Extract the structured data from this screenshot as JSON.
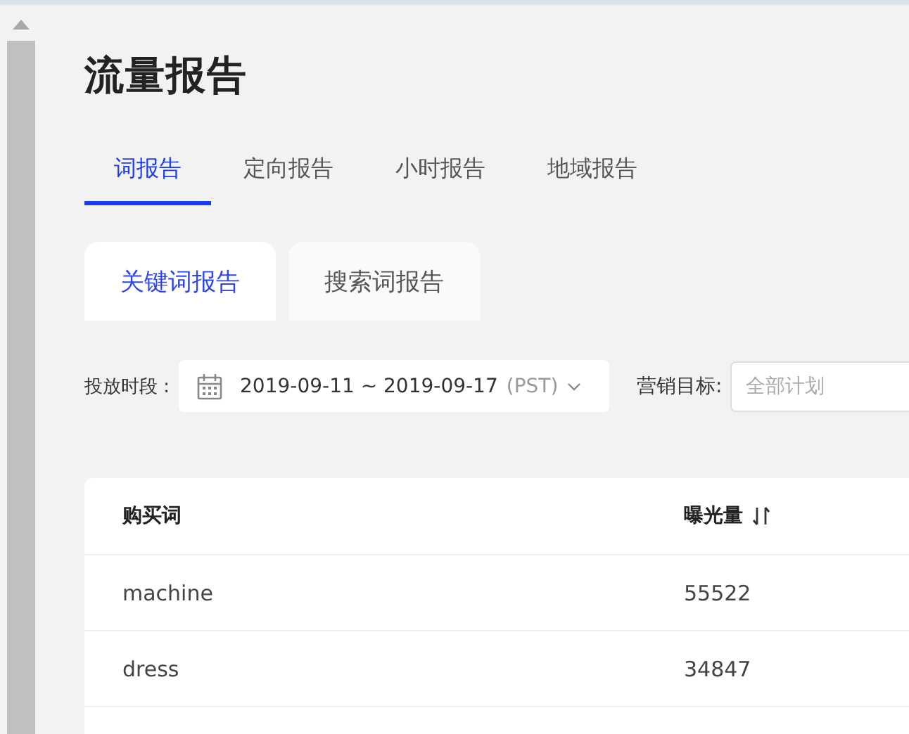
{
  "title": "流量报告",
  "tabs": [
    {
      "label": "词报告",
      "selected": true
    },
    {
      "label": "定向报告",
      "selected": false
    },
    {
      "label": "小时报告",
      "selected": false
    },
    {
      "label": "地域报告",
      "selected": false
    }
  ],
  "subtabs": [
    {
      "label": "关键词报告",
      "selected": true
    },
    {
      "label": "搜索词报告",
      "selected": false
    }
  ],
  "filters": {
    "period_label": "投放时段 :",
    "date_range": "2019-09-11 ~ 2019-09-17",
    "timezone": "(PST)",
    "goal_label": "营销目标:",
    "goal_placeholder": "全部计划"
  },
  "table": {
    "columns": [
      {
        "label": "购买词",
        "sortable": false
      },
      {
        "label": "曝光量",
        "sortable": true
      }
    ],
    "rows": [
      [
        "machine",
        "55522"
      ],
      [
        "dress",
        "34847"
      ]
    ]
  }
}
